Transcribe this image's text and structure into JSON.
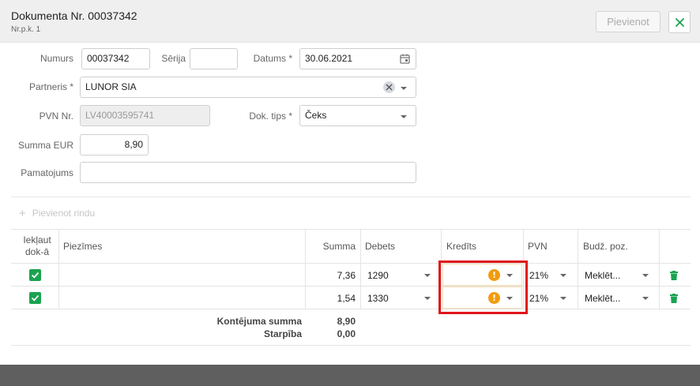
{
  "header": {
    "title": "Dokumenta Nr. 00037342",
    "subtitle": "Nr.p.k. 1",
    "add_button": "Pievienot"
  },
  "form": {
    "numurs_label": "Numurs",
    "numurs_value": "00037342",
    "serija_label": "Sērija",
    "serija_value": "",
    "datums_label": "Datums *",
    "datums_value": "30.06.2021",
    "partneris_label": "Partneris *",
    "partneris_value": "LUNOR SIA",
    "pvn_label": "PVN Nr.",
    "pvn_value": "LV40003595741",
    "dok_tips_label": "Dok. tips *",
    "dok_tips_value": "Čeks",
    "summa_label": "Summa EUR",
    "summa_value": "8,90",
    "pamatojums_label": "Pamatojums",
    "pamatojums_value": ""
  },
  "add_row_label": "Pievienot rindu",
  "table": {
    "headers": {
      "include": "Iekļaut dok-ā",
      "notes": "Piezīmes",
      "summa": "Summa",
      "debets": "Debets",
      "kredits": "Kredīts",
      "pvn": "PVN",
      "budz": "Budž. poz."
    },
    "rows": [
      {
        "summa": "7,36",
        "debets": "1290",
        "kredits": "",
        "pvn": "21%",
        "budz": "Meklēt..."
      },
      {
        "summa": "1,54",
        "debets": "1330",
        "kredits": "",
        "pvn": "21%",
        "budz": "Meklēt..."
      }
    ],
    "totals": {
      "kontejuma_label": "Kontējuma summa",
      "kontejuma_value": "8,90",
      "starpiba_label": "Starpība",
      "starpiba_value": "0,00"
    }
  },
  "colors": {
    "check_green": "#1aa350",
    "warning_orange": "#f29b0c",
    "highlight_red": "#e0161b"
  },
  "icons": [
    "close-icon",
    "calendar-icon",
    "clear-icon",
    "chevron-down-icon",
    "plus-icon",
    "checkbox-checked-icon",
    "warning-icon",
    "trash-icon"
  ]
}
